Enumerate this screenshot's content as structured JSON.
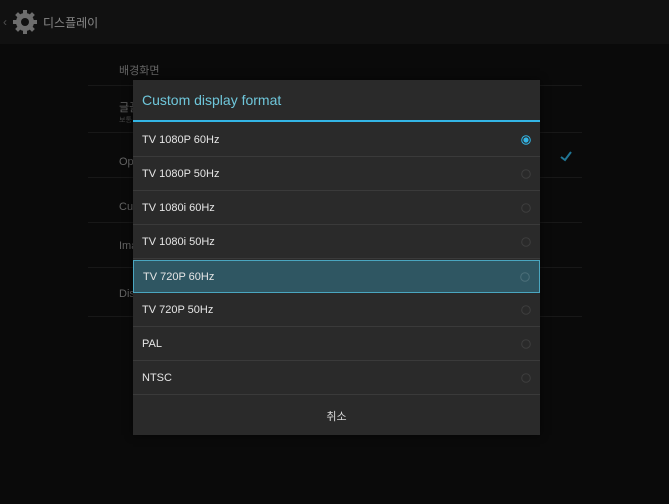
{
  "actionbar": {
    "title": "디스플레이"
  },
  "settings": {
    "rows": [
      {
        "label": "배경화면",
        "sub": ""
      },
      {
        "label": "글꼴",
        "sub": "보통"
      },
      {
        "label": "Op",
        "sub": ""
      },
      {
        "label": "Cu",
        "sub": ""
      },
      {
        "label": "Ima",
        "sub": ""
      },
      {
        "label": "Dis",
        "sub": ""
      }
    ]
  },
  "dialog": {
    "title": "Custom display format",
    "options": [
      {
        "label": "TV 1080P 60Hz",
        "checked": true
      },
      {
        "label": "TV 1080P 50Hz",
        "checked": false
      },
      {
        "label": "TV 1080i 60Hz",
        "checked": false
      },
      {
        "label": "TV 1080i 50Hz",
        "checked": false
      },
      {
        "label": "TV 720P 60Hz",
        "checked": false,
        "focused": true
      },
      {
        "label": "TV 720P 50Hz",
        "checked": false
      },
      {
        "label": "PAL",
        "checked": false
      },
      {
        "label": "NTSC",
        "checked": false
      }
    ],
    "cancel_label": "취소"
  },
  "colors": {
    "accent": "#33b5e5",
    "focus_bg": "#2f5662"
  },
  "icons": {
    "app": "gear-icon",
    "radio_on": "radio-checked-icon",
    "radio_off": "radio-unchecked-icon",
    "check": "checkmark-icon"
  }
}
